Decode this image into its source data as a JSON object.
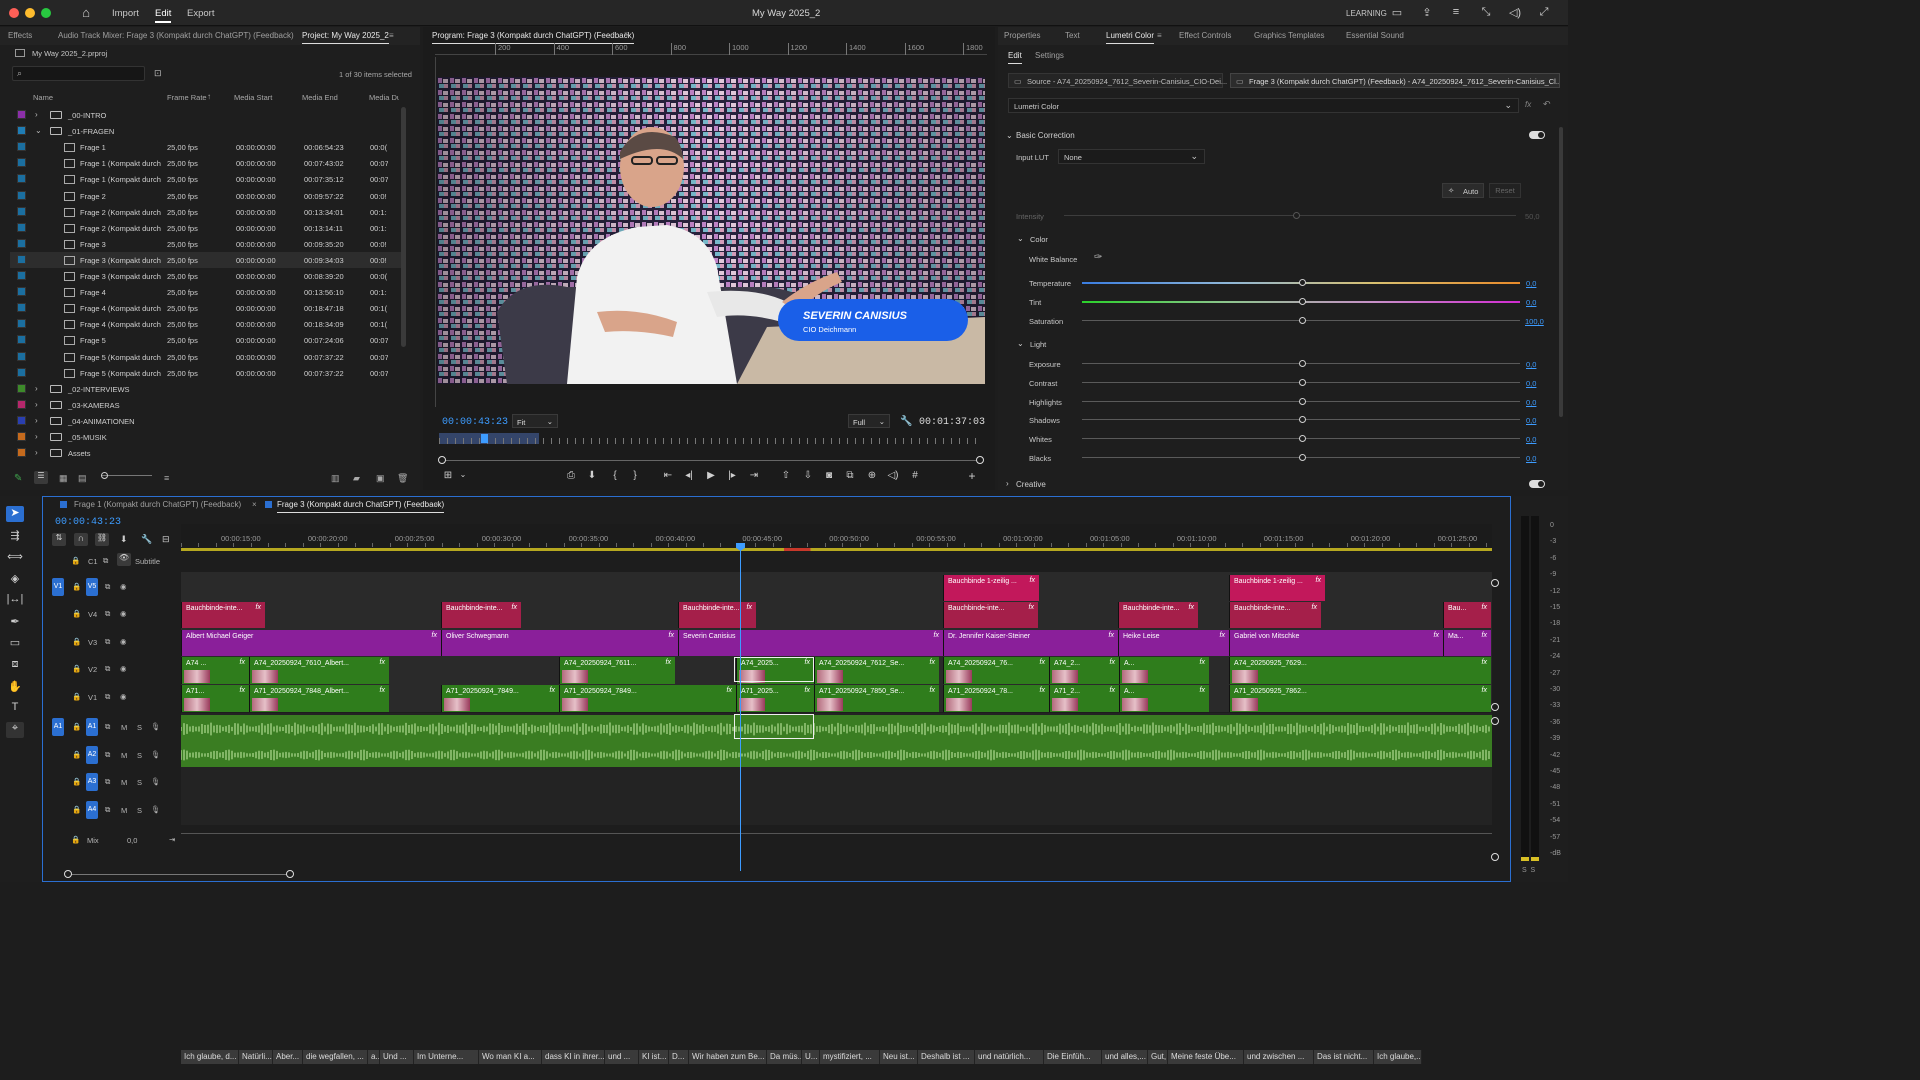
{
  "titlebar": {
    "title": "My Way 2025_2",
    "menus": [
      "Import",
      "Edit",
      "Export"
    ],
    "workspace": "LEARNING"
  },
  "project": {
    "tabs": [
      "Effects",
      "Audio Track Mixer: Frage 3 (Kompakt durch ChatGPT) (Feedback)",
      "Project: My Way 2025_2"
    ],
    "file": "My Way 2025_2.prproj",
    "search_placeholder": "",
    "count": "1 of 30 items selected",
    "columns": [
      "Name",
      "Frame Rate",
      "Media Start",
      "Media End",
      "Media Du"
    ],
    "rows": [
      {
        "name": "_00-INTRO",
        "folder": true,
        "open": false,
        "indent": 0,
        "color": "#8b2fa8",
        "fr": "",
        "ms": "",
        "me": "",
        "md": ""
      },
      {
        "name": "_01-FRAGEN",
        "folder": true,
        "open": true,
        "indent": 0,
        "color": "#1f7db5",
        "fr": "",
        "ms": "",
        "me": "",
        "md": ""
      },
      {
        "name": "Frage 1",
        "folder": false,
        "indent": 1,
        "color": "#1b6fa0",
        "fr": "25,00 fps",
        "ms": "00:00:00:00",
        "me": "00:06:54:23",
        "md": "00:0("
      },
      {
        "name": "Frage 1 (Kompakt durch",
        "folder": false,
        "indent": 1,
        "color": "#1b6fa0",
        "fr": "25,00 fps",
        "ms": "00:00:00:00",
        "me": "00:07:43:02",
        "md": "00:07"
      },
      {
        "name": "Frage 1 (Kompakt durch",
        "folder": false,
        "indent": 1,
        "color": "#1b6fa0",
        "fr": "25,00 fps",
        "ms": "00:00:00:00",
        "me": "00:07:35:12",
        "md": "00:07"
      },
      {
        "name": "Frage 2",
        "folder": false,
        "indent": 1,
        "color": "#1b6fa0",
        "fr": "25,00 fps",
        "ms": "00:00:00:00",
        "me": "00:09:57:22",
        "md": "00:0!"
      },
      {
        "name": "Frage 2 (Kompakt durch",
        "folder": false,
        "indent": 1,
        "color": "#1b6fa0",
        "fr": "25,00 fps",
        "ms": "00:00:00:00",
        "me": "00:13:34:01",
        "md": "00:1:"
      },
      {
        "name": "Frage 2 (Kompakt durch",
        "folder": false,
        "indent": 1,
        "color": "#1b6fa0",
        "fr": "25,00 fps",
        "ms": "00:00:00:00",
        "me": "00:13:14:11",
        "md": "00:1:"
      },
      {
        "name": "Frage 3",
        "folder": false,
        "indent": 1,
        "color": "#1b6fa0",
        "fr": "25,00 fps",
        "ms": "00:00:00:00",
        "me": "00:09:35:20",
        "md": "00:0!"
      },
      {
        "name": "Frage 3 (Kompakt durch",
        "folder": false,
        "indent": 1,
        "color": "#1b6fa0",
        "fr": "25,00 fps",
        "ms": "00:00:00:00",
        "me": "00:09:34:03",
        "md": "00:0!",
        "sel": true
      },
      {
        "name": "Frage 3 (Kompakt durch",
        "folder": false,
        "indent": 1,
        "color": "#1b6fa0",
        "fr": "25,00 fps",
        "ms": "00:00:00:00",
        "me": "00:08:39:20",
        "md": "00:0("
      },
      {
        "name": "Frage 4",
        "folder": false,
        "indent": 1,
        "color": "#1b6fa0",
        "fr": "25,00 fps",
        "ms": "00:00:00:00",
        "me": "00:13:56:10",
        "md": "00:1:"
      },
      {
        "name": "Frage 4 (Kompakt durch",
        "folder": false,
        "indent": 1,
        "color": "#1b6fa0",
        "fr": "25,00 fps",
        "ms": "00:00:00:00",
        "me": "00:18:47:18",
        "md": "00:1("
      },
      {
        "name": "Frage 4 (Kompakt durch",
        "folder": false,
        "indent": 1,
        "color": "#1b6fa0",
        "fr": "25,00 fps",
        "ms": "00:00:00:00",
        "me": "00:18:34:09",
        "md": "00:1("
      },
      {
        "name": "Frage 5",
        "folder": false,
        "indent": 1,
        "color": "#1b6fa0",
        "fr": "25,00 fps",
        "ms": "00:00:00:00",
        "me": "00:07:24:06",
        "md": "00:07"
      },
      {
        "name": "Frage 5 (Kompakt durch",
        "folder": false,
        "indent": 1,
        "color": "#1b6fa0",
        "fr": "25,00 fps",
        "ms": "00:00:00:00",
        "me": "00:07:37:22",
        "md": "00:07"
      },
      {
        "name": "Frage 5 (Kompakt durch",
        "folder": false,
        "indent": 1,
        "color": "#1b6fa0",
        "fr": "25,00 fps",
        "ms": "00:00:00:00",
        "me": "00:07:37:22",
        "md": "00:07"
      },
      {
        "name": "_02-INTERVIEWS",
        "folder": true,
        "open": false,
        "indent": 0,
        "color": "#3d8a2a",
        "fr": "",
        "ms": "",
        "me": "",
        "md": ""
      },
      {
        "name": "_03-KAMERAS",
        "folder": true,
        "open": false,
        "indent": 0,
        "color": "#b5276b",
        "fr": "",
        "ms": "",
        "me": "",
        "md": ""
      },
      {
        "name": "_04-ANIMATIONEN",
        "folder": true,
        "open": false,
        "indent": 0,
        "color": "#2a3fb0",
        "fr": "",
        "ms": "",
        "me": "",
        "md": ""
      },
      {
        "name": "_05-MUSIK",
        "folder": true,
        "open": false,
        "indent": 0,
        "color": "#c56a1d",
        "fr": "",
        "ms": "",
        "me": "",
        "md": ""
      },
      {
        "name": "Assets",
        "folder": true,
        "open": false,
        "indent": 0,
        "color": "#c56a1d",
        "fr": "",
        "ms": "",
        "me": "",
        "md": ""
      }
    ]
  },
  "program": {
    "title": "Program: Frage 3 (Kompakt durch ChatGPT) (Feedback)",
    "ruler": [
      "200",
      "400",
      "600",
      "800",
      "1000",
      "1200",
      "1400",
      "1600",
      "1800"
    ],
    "lower_third": {
      "name": "SEVERIN CANISIUS",
      "role": "CIO Deichmann"
    },
    "timecode": "00:00:43:23",
    "fit": "Fit",
    "quality": "Full",
    "duration": "00:01:37:03"
  },
  "lumetri": {
    "tabs": [
      "Properties",
      "Text",
      "Lumetri Color",
      "Effect Controls",
      "Graphics Templates",
      "Essential Sound"
    ],
    "subtabs": [
      "Edit",
      "Settings"
    ],
    "source": "Source - A74_20250924_7612_Severin-Canisius_CIO-Dei...",
    "target": "Frage 3 (Kompakt durch ChatGPT) (Feedback) - A74_20250924_7612_Severin-Canisius_Cl...",
    "effect": "Lumetri Color",
    "basic": "Basic Correction",
    "input_lut_label": "Input LUT",
    "input_lut": "None",
    "auto": "Auto",
    "reset": "Reset",
    "intensity": "Intensity",
    "intensity_val": "50,0",
    "color_section": "Color",
    "white_balance": "White Balance",
    "color_sliders": [
      {
        "name": "Temperature",
        "value": "0,0"
      },
      {
        "name": "Tint",
        "value": "0,0"
      },
      {
        "name": "Saturation",
        "value": "100,0"
      }
    ],
    "light_section": "Light",
    "light_sliders": [
      {
        "name": "Exposure",
        "value": "0,0"
      },
      {
        "name": "Contrast",
        "value": "0,0"
      },
      {
        "name": "Highlights",
        "value": "0,0"
      },
      {
        "name": "Shadows",
        "value": "0,0"
      },
      {
        "name": "Whites",
        "value": "0,0"
      },
      {
        "name": "Blacks",
        "value": "0,0"
      }
    ],
    "creative": "Creative"
  },
  "timeline": {
    "tabs": [
      "Frage 1 (Kompakt durch ChatGPT) (Feedback)",
      "Frage 3 (Kompakt durch ChatGPT) (Feedback)"
    ],
    "timecode": "00:00:43:23",
    "ruler": [
      "00:00:15:00",
      "00:00:20:00",
      "00:00:25:00",
      "00:00:30:00",
      "00:00:35:00",
      "00:00:40:00",
      "00:00:45:00",
      "00:00:50:00",
      "00:00:55:00",
      "00:01:00:00",
      "00:01:05:00",
      "00:01:10:00",
      "00:01:15:00",
      "00:01:20:00",
      "00:01:25:00"
    ],
    "caption_track": "C1",
    "caption_label": "Subtitle",
    "captions": [
      "Ich glaube, d...",
      "Natürli...",
      "Aber...",
      "die wegfallen, ...",
      "a...",
      "Und ...",
      "Im Unterne...",
      "Wo man KI a...",
      "dass KI in ihrer...",
      "und ...",
      "KI ist...",
      "D...",
      "Wir haben zum Be...",
      "Da müs...",
      "U...",
      "mystifiziert, ...",
      "Neu ist...",
      "Deshalb ist ...",
      "und natürlich...",
      "Die Einfüh...",
      "und alles,...",
      "Gut, ...",
      "Meine feste Übe...",
      "und zwischen ...",
      "Das ist nicht...",
      "Ich glaube,..."
    ],
    "video_tracks": [
      "V5",
      "V4",
      "V3",
      "V2",
      "V1"
    ],
    "audio_tracks": [
      "A1",
      "A2",
      "A3",
      "A4"
    ],
    "mix": "Mix",
    "mix_val": "0,0",
    "v5": [
      {
        "n": "Bauchbinde 1-zeilig ..."
      },
      {
        "n": "Bauchbinde 1-zeilig ..."
      }
    ],
    "v4": [
      {
        "n": "Bauchbinde-inte..."
      },
      {
        "n": "Bauchbinde-inte..."
      },
      {
        "n": "Bauchbinde-inte..."
      },
      {
        "n": "Bauchbinde-inte..."
      },
      {
        "n": "Bauchbinde-inte..."
      },
      {
        "n": "Bauchbinde-inte..."
      },
      {
        "n": "Bau..."
      }
    ],
    "v3": [
      {
        "n": "Albert Michael Geiger"
      },
      {
        "n": "Oliver Schwegmann"
      },
      {
        "n": "Severin Canisius"
      },
      {
        "n": "Dr. Jennifer Kaiser-Steiner"
      },
      {
        "n": "Heike Leise"
      },
      {
        "n": "Gabriel von Mitschke"
      },
      {
        "n": "Ma..."
      }
    ],
    "v2": [
      {
        "n": "A74 ..."
      },
      {
        "n": "A74_20250924_7610_Albert..."
      },
      {
        "n": "A74_20250924_7611..."
      },
      {
        "n": "A74_20250924_7611..."
      },
      {
        "n": "A74_2025..."
      },
      {
        "n": "A74_20250924_7612_Se..."
      },
      {
        "n": "A74_20250924_76..."
      },
      {
        "n": "A74_2..."
      },
      {
        "n": "A..."
      },
      {
        "n": "A74_20250925_7629..."
      }
    ],
    "v1": [
      {
        "n": "A71..."
      },
      {
        "n": "A71_20250924_7848_Albert..."
      },
      {
        "n": "A71_20250924_7849..."
      },
      {
        "n": "A71_20250924_7849..."
      },
      {
        "n": "A71_2025..."
      },
      {
        "n": "A71_20250924_7850_Se..."
      },
      {
        "n": "A71_20250924_78..."
      },
      {
        "n": "A71_2..."
      },
      {
        "n": "A..."
      },
      {
        "n": "A71_20250925_7862..."
      }
    ],
    "meter": [
      "0",
      "-3",
      "-6",
      "-9",
      "-12",
      "-15",
      "-18",
      "-21",
      "-24",
      "-27",
      "-30",
      "-33",
      "-36",
      "-39",
      "-42",
      "-45",
      "-48",
      "-51",
      "-54",
      "-57",
      "-dB"
    ],
    "meter_ss": "S  S"
  },
  "colors": {
    "accent": "#2b6fd1",
    "playhead": "#3d9cff",
    "video": "#2f7d1c",
    "graphic": "#a51f4a",
    "title": "#8a1f9a",
    "audio": "#3f8a24"
  }
}
